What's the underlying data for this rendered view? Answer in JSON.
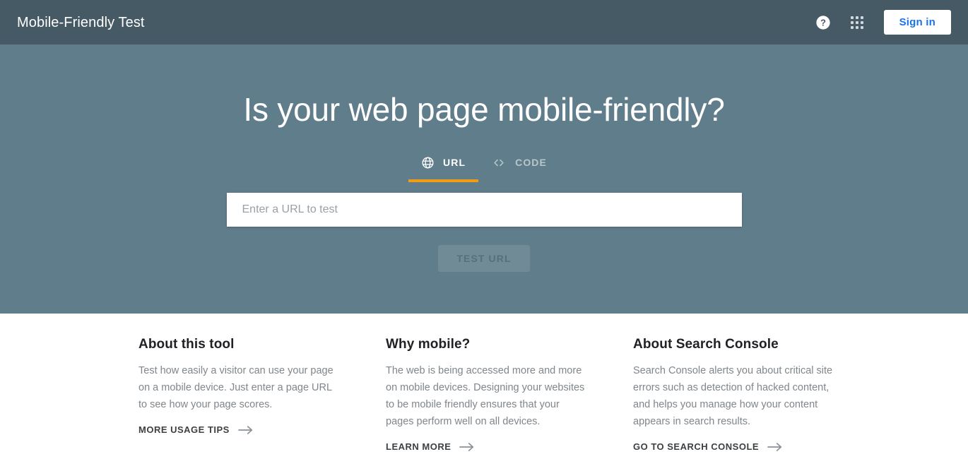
{
  "header": {
    "title": "Mobile-Friendly Test",
    "help_icon": "help-circle-icon",
    "apps_icon": "apps-grid-icon",
    "signin_label": "Sign in"
  },
  "hero": {
    "title": "Is your web page mobile-friendly?",
    "tabs": [
      {
        "label": "URL",
        "icon": "globe-icon",
        "active": true
      },
      {
        "label": "CODE",
        "icon": "code-brackets-icon",
        "active": false
      }
    ],
    "input": {
      "placeholder": "Enter a URL to test",
      "value": ""
    },
    "submit_label": "TEST URL",
    "accent_color": "#f39c12",
    "background_color": "#607d8b",
    "header_color": "#455a64"
  },
  "cards": [
    {
      "title": "About this tool",
      "body": "Test how easily a visitor can use your page on a mobile device. Just enter a page URL to see how your page scores.",
      "link_label": "MORE USAGE TIPS",
      "link_icon": "arrow-right-icon"
    },
    {
      "title": "Why mobile?",
      "body": "The web is being accessed more and more on mobile devices. Designing your websites to be mobile friendly ensures that your pages perform well on all devices.",
      "link_label": "LEARN MORE",
      "link_icon": "arrow-right-icon"
    },
    {
      "title": "About Search Console",
      "body": "Search Console alerts you about critical site errors such as detection of hacked content, and helps you manage how your content appears in search results.",
      "link_label": "GO TO SEARCH CONSOLE",
      "link_icon": "arrow-right-icon"
    }
  ]
}
